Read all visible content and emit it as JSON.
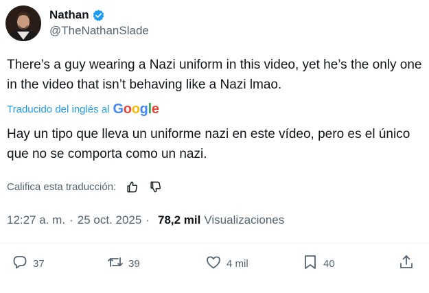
{
  "author": {
    "display_name": "Nathan",
    "handle": "@TheNathanSlade",
    "verified": true
  },
  "tweet": {
    "original_text": "There’s a guy wearing a Nazi uniform in this video, yet he’s the only one in the video that isn’t behaving like a Nazi lmao.",
    "translated_by_label": "Traducido del inglés al",
    "translation_provider": "Google",
    "translated_text": "Hay un tipo que lleva un uniforme nazi en este vídeo, pero es el único que no se comporta como un nazi.",
    "rate_translation_label": "Califica esta traducción:",
    "time": "12:27 a. m.",
    "separator": "·",
    "date": "25 oct. 2025",
    "views_count": "78,2 mil",
    "views_label": "Visualizaciones"
  },
  "actions": {
    "replies": "37",
    "reposts": "39",
    "likes": "4 mil",
    "bookmarks": "40"
  },
  "icons": {
    "verified": "verified-badge-icon",
    "thumbs_up": "thumbs-up-icon",
    "thumbs_down": "thumbs-down-icon",
    "reply": "reply-icon",
    "repost": "repost-icon",
    "like": "heart-icon",
    "bookmark": "bookmark-icon",
    "share": "share-icon"
  },
  "colors": {
    "accent": "#1d9bf0",
    "text_primary": "#0f1419",
    "text_secondary": "#536471"
  }
}
